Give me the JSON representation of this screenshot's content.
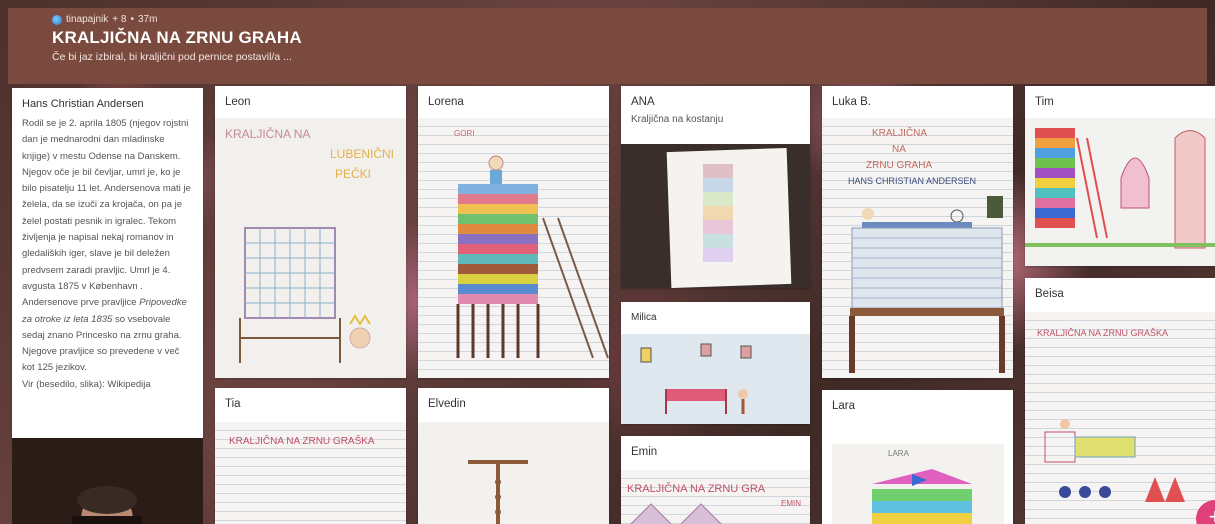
{
  "header": {
    "author": "tinapajnik",
    "plus": "+ 8",
    "separator": "•",
    "time": "37m",
    "title": "KRALJIČNA NA ZRNU GRAHA",
    "subtitle": "Če bi jaz izbiral, bi kraljični pod pernice postavil/a ..."
  },
  "intro": {
    "title": "Hans Christian Andersen",
    "paragraph1": "Rodil se je 2. aprila 1805 (njegov rojstni dan je mednarodni dan mladinske knjige) v mestu Odense na Danskem. Njegov oče je bil čevljar, umrl je, ko je bilo pisatelju 11 let. Andersenova mati je želela, da se izuči za krojača, on pa je želel postati pesnik in igralec. Tekom življenja je napisal nekaj romanov in gledaliških iger, slave je bil deležen predvsem zaradi pravljic. Umrl je 4. avgusta 1875 v København .",
    "paragraph2_start": "Andersenove prve pravljice",
    "paragraph2_italic": "Pripovedke za otroke iz leta 1835",
    "paragraph2_end": "so vsebovale sedaj znano Princesko na zrnu graha. Njegove pravljice so prevedene v več kot 125 jezikov.",
    "source": "Vir (besedilo, slika): Wikipedija"
  },
  "posts": {
    "leon": {
      "name": "Leon",
      "drawing_text": [
        "KRALJIČNA NA",
        "LUBENIČNI",
        "PEČKI"
      ]
    },
    "lorena": {
      "name": "Lorena",
      "drawing_text": [
        "GORI"
      ]
    },
    "ana": {
      "name": "ANA",
      "caption": "Kraljična na kostanju"
    },
    "milica": {
      "name": "Milica"
    },
    "luka": {
      "name": "Luka B.",
      "drawing_text": [
        "KRALJIČNA",
        "NA",
        "ZRNU GRAHA",
        "HANS CHRISTIAN ANDERSEN"
      ]
    },
    "tim": {
      "name": "Tim"
    },
    "beisa": {
      "name": "Beisa",
      "drawing_text": [
        "KRALJIČNA NA ZRNU GRAŠKA"
      ]
    },
    "tia": {
      "name": "Tia",
      "drawing_text": [
        "KRALJIČNA NA ZRNU GRAŠKA"
      ]
    },
    "elvedin": {
      "name": "Elvedin"
    },
    "emin": {
      "name": "Emin",
      "drawing_text": [
        "KRALJIČNA NA ZRNU GRA",
        "EMIN"
      ]
    },
    "lara": {
      "name": "Lara",
      "drawing_text": [
        "LARA"
      ]
    }
  },
  "fab": {
    "label": "+"
  },
  "colors": {
    "header": "#7a4a3e",
    "card": "#ffffff",
    "fab": "#e0407a"
  }
}
